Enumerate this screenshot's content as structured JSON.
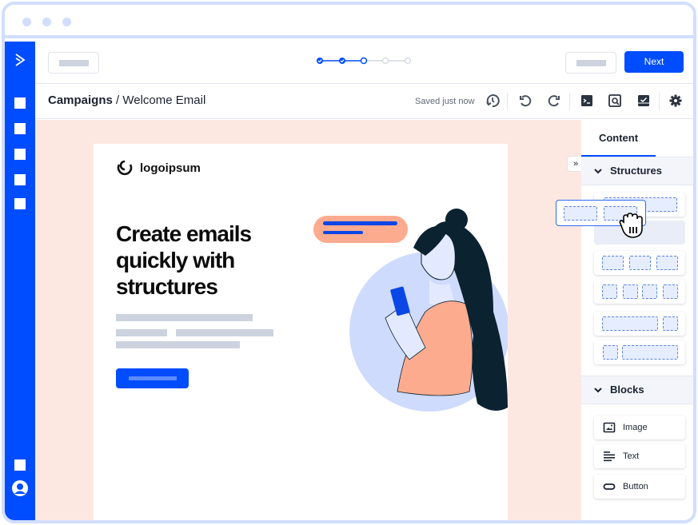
{
  "window": {
    "dots": 3
  },
  "sidebar": {
    "logo_icon": "chevron-right-double-icon",
    "nav_items": 5,
    "bottom_items": [
      "square-icon",
      "user-avatar-icon"
    ]
  },
  "topbar": {
    "secondary_button_placeholder": "",
    "next_label": "Next",
    "stepper": {
      "total_steps": 5,
      "completed_steps": 2,
      "current_step": 3
    }
  },
  "subbar": {
    "breadcrumb_parent": "Campaigns",
    "breadcrumb_separator": " / ",
    "breadcrumb_current": "Welcome Email",
    "save_status": "Saved just now",
    "toolbar_icons": [
      "history-icon",
      "undo-icon",
      "redo-icon",
      "code-icon",
      "preview-icon",
      "checklist-icon",
      "gear-icon"
    ]
  },
  "email": {
    "logo_text": "logoipsum",
    "headline": "Create emails quickly with structures"
  },
  "panel": {
    "tab_label": "Content",
    "collapse_label": "»",
    "structures_label": "Structures",
    "blocks_label": "Blocks",
    "blocks": [
      {
        "label": "Image",
        "icon": "image-icon"
      },
      {
        "label": "Text",
        "icon": "text-align-icon"
      },
      {
        "label": "Button",
        "icon": "button-shape-icon"
      }
    ]
  },
  "colors": {
    "brand": "#004cff",
    "canvas_bg": "#fde8e1",
    "frame": "#d2defd",
    "placeholder": "#ccd3df"
  }
}
